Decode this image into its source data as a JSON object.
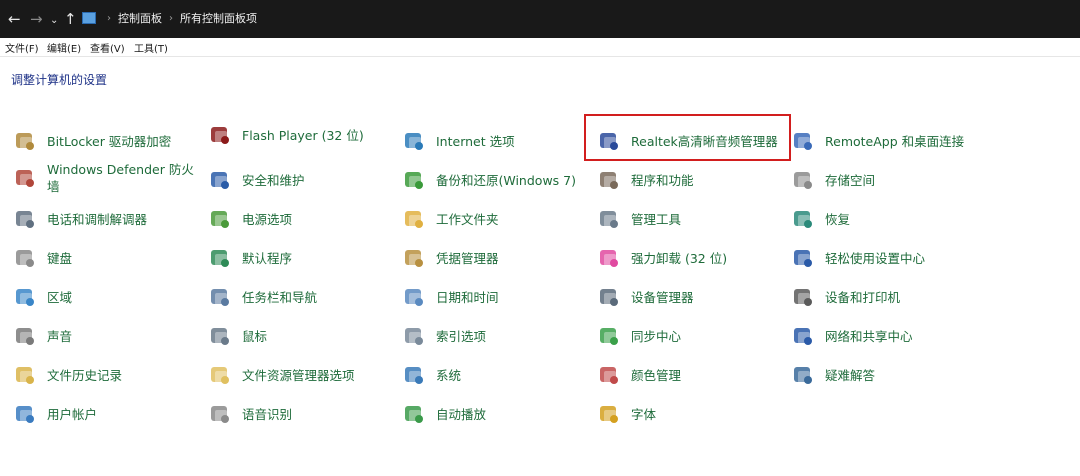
{
  "window": {
    "breadcrumbs": [
      "控制面板",
      "所有控制面板项"
    ]
  },
  "menu": [
    "文件(F)",
    "编辑(E)",
    "查看(V)",
    "工具(T)"
  ],
  "heading": "调整计算机的设置",
  "items": [
    {
      "label": "BitLocker 驱动器加密",
      "icon": "key-icon",
      "color": "#b08a3c"
    },
    {
      "label": "Windows Defender 防火墙",
      "icon": "firewall-icon",
      "color": "#b0463a"
    },
    {
      "label": "电话和调制解调器",
      "icon": "modem-icon",
      "color": "#607080"
    },
    {
      "label": "键盘",
      "icon": "keyboard-icon",
      "color": "#8a8a8a"
    },
    {
      "label": "区域",
      "icon": "globe-icon",
      "color": "#3a86c8"
    },
    {
      "label": "声音",
      "icon": "speaker-icon",
      "color": "#7a7a7a"
    },
    {
      "label": "文件历史记录",
      "icon": "file-history-icon",
      "color": "#d9b44a"
    },
    {
      "label": "用户帐户",
      "icon": "users-icon",
      "color": "#3a7bbf"
    },
    {
      "label": "Flash Player (32 位)",
      "icon": "flash-icon",
      "color": "#8b1a1a"
    },
    {
      "label": "安全和维护",
      "icon": "flag-icon",
      "color": "#2a5ca8"
    },
    {
      "label": "电源选项",
      "icon": "power-icon",
      "color": "#4a9a3a"
    },
    {
      "label": "默认程序",
      "icon": "default-programs-icon",
      "color": "#2e8b57"
    },
    {
      "label": "任务栏和导航",
      "icon": "taskbar-icon",
      "color": "#5a7aa0"
    },
    {
      "label": "鼠标",
      "icon": "mouse-icon",
      "color": "#6a7a8a"
    },
    {
      "label": "文件资源管理器选项",
      "icon": "folder-options-icon",
      "color": "#e0c060"
    },
    {
      "label": "语音识别",
      "icon": "microphone-icon",
      "color": "#8a8a8a"
    },
    {
      "label": "Internet 选项",
      "icon": "internet-options-icon",
      "color": "#2a7ab8"
    },
    {
      "label": "备份和还原(Windows 7)",
      "icon": "backup-icon",
      "color": "#3a9a3a"
    },
    {
      "label": "工作文件夹",
      "icon": "work-folders-icon",
      "color": "#e0b040"
    },
    {
      "label": "凭据管理器",
      "icon": "credential-icon",
      "color": "#b89040"
    },
    {
      "label": "日期和时间",
      "icon": "calendar-icon",
      "color": "#5a8ac0"
    },
    {
      "label": "索引选项",
      "icon": "index-icon",
      "color": "#7a8a9a"
    },
    {
      "label": "系统",
      "icon": "system-icon",
      "color": "#3a7ab8"
    },
    {
      "label": "自动播放",
      "icon": "autoplay-icon",
      "color": "#3a9a4a"
    },
    {
      "label": "Realtek高清晰音频管理器",
      "icon": "realtek-icon",
      "color": "#2a4a9a"
    },
    {
      "label": "程序和功能",
      "icon": "programs-icon",
      "color": "#7a6a5a"
    },
    {
      "label": "管理工具",
      "icon": "admin-tools-icon",
      "color": "#6a7a8a"
    },
    {
      "label": "强力卸载 (32 位)",
      "icon": "uninstall-icon",
      "color": "#e04aa0"
    },
    {
      "label": "设备管理器",
      "icon": "device-manager-icon",
      "color": "#5a6a7a"
    },
    {
      "label": "同步中心",
      "icon": "sync-icon",
      "color": "#3aa04a"
    },
    {
      "label": "颜色管理",
      "icon": "color-icon",
      "color": "#c04a4a"
    },
    {
      "label": "字体",
      "icon": "font-icon",
      "color": "#d4a020"
    },
    {
      "label": "RemoteApp 和桌面连接",
      "icon": "remoteapp-icon",
      "color": "#3a6ab8"
    },
    {
      "label": "存储空间",
      "icon": "storage-icon",
      "color": "#8a8a8a"
    },
    {
      "label": "恢复",
      "icon": "recovery-icon",
      "color": "#2a8a7a"
    },
    {
      "label": "轻松使用设置中心",
      "icon": "ease-of-access-icon",
      "color": "#2a5aa8"
    },
    {
      "label": "设备和打印机",
      "icon": "printer-icon",
      "color": "#5a5a5a"
    },
    {
      "label": "网络和共享中心",
      "icon": "network-icon",
      "color": "#2a5aa8"
    },
    {
      "label": "疑难解答",
      "icon": "troubleshoot-icon",
      "color": "#3a6a9a"
    }
  ],
  "highlighted_item": "Realtek高清晰音频管理器",
  "highlight_color": "#d21e1e",
  "link_color": "#1e6b3a",
  "heading_color": "#1e3287"
}
